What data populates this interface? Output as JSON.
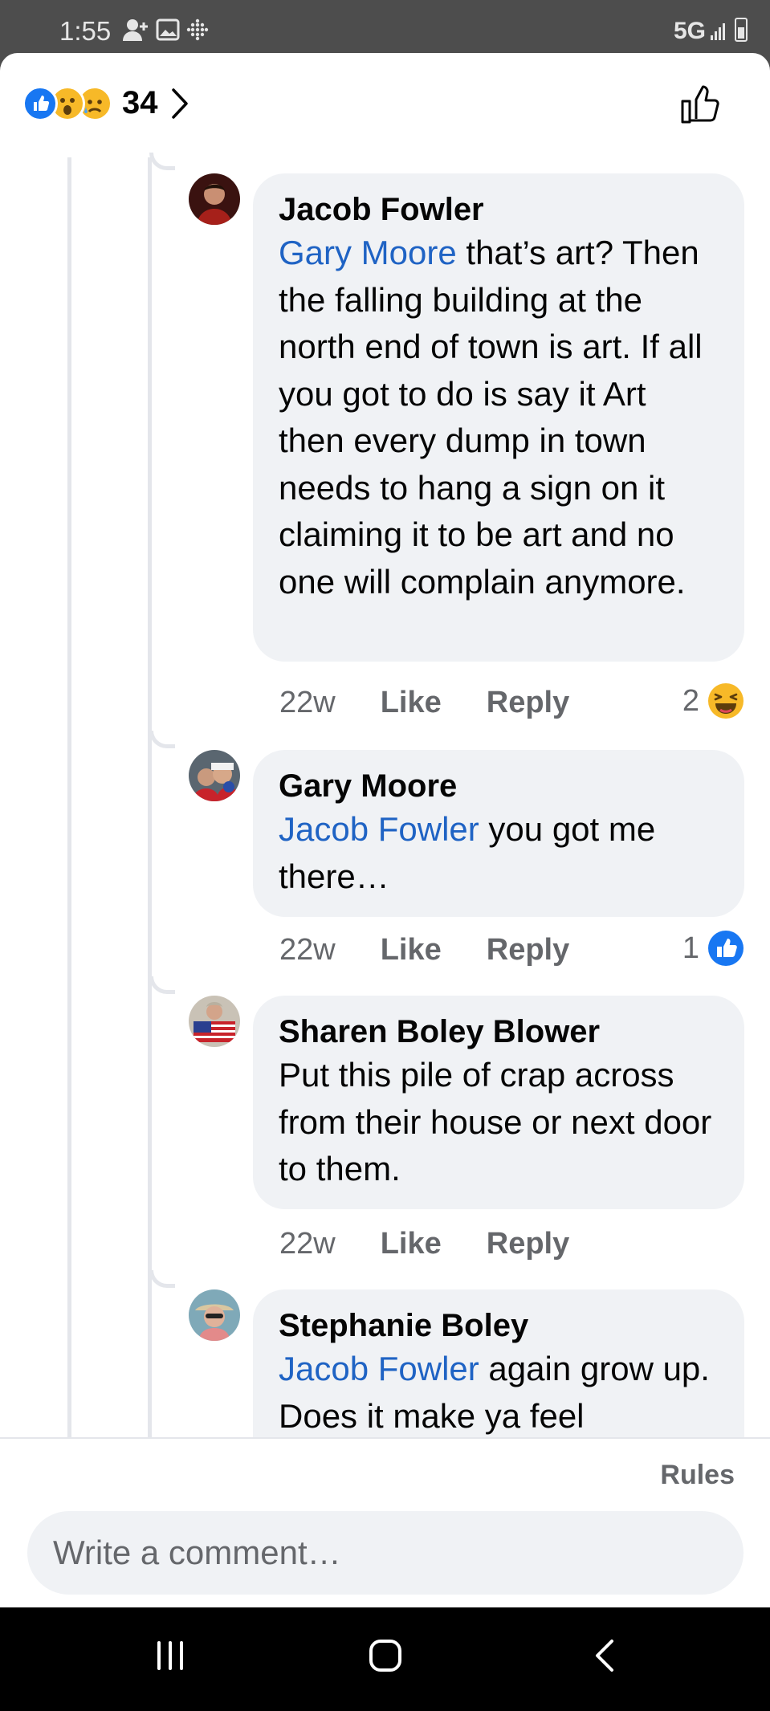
{
  "status_bar": {
    "time": "1:55",
    "network": "5G"
  },
  "header": {
    "reaction_count": "34"
  },
  "comments": [
    {
      "author": "Jacob Fowler",
      "mention": "Gary Moore",
      "text": " that’s art? Then the falling building at the north end of town is art. If all you got to do is say it Art then every dump in town needs to hang a sign on it claiming it to be art and no one will complain anymore.",
      "age": "22w",
      "like": "Like",
      "reply": "Reply",
      "reaction_count": "2",
      "reaction_icon": "laugh-icon"
    },
    {
      "author": "Gary Moore",
      "mention": "Jacob Fowler",
      "text": " you got me there…",
      "age": "22w",
      "like": "Like",
      "reply": "Reply",
      "reaction_count": "1",
      "reaction_icon": "like-icon"
    },
    {
      "author": "Sharen Boley Blower",
      "mention": "",
      "text": "Put this pile of crap across from their house or next door to them.",
      "age": "22w",
      "like": "Like",
      "reply": "Reply"
    },
    {
      "author": "Stephanie Boley",
      "mention": "Jacob Fowler",
      "text": " again grow up. Does it make ya feel"
    }
  ],
  "footer": {
    "rules": "Rules",
    "composer_placeholder": "Write a comment…"
  },
  "colors": {
    "accent": "#1877f2",
    "mention": "#1f63c4",
    "bubble": "#f0f2f5",
    "muted": "#65676b"
  }
}
